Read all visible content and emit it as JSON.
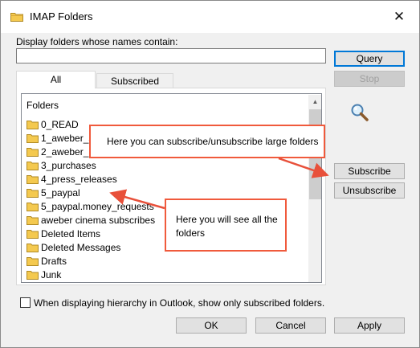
{
  "window": {
    "title": "IMAP Folders",
    "close_glyph": "✕"
  },
  "filter": {
    "label": "Display folders whose names contain:",
    "value": "",
    "query_label": "Query",
    "stop_label": "Stop"
  },
  "tabs": [
    {
      "label": "All",
      "selected": true
    },
    {
      "label": "Subscribed",
      "selected": false
    }
  ],
  "folder_list": {
    "header": "Folders",
    "items": [
      {
        "label": "0_READ"
      },
      {
        "label": "1_aweber_su"
      },
      {
        "label": "2_aweber_ur"
      },
      {
        "label": "3_purchases"
      },
      {
        "label": "4_press_releases"
      },
      {
        "label": "5_paypal"
      },
      {
        "label": "5_paypal.money_requests"
      },
      {
        "label": "aweber cinema subscribes"
      },
      {
        "label": "Deleted Items"
      },
      {
        "label": "Deleted Messages"
      },
      {
        "label": "Drafts"
      },
      {
        "label": "Junk"
      }
    ]
  },
  "side_buttons": {
    "search_icon": "magnifier-icon",
    "subscribe_label": "Subscribe",
    "unsubscribe_label": "Unsubscribe"
  },
  "callouts": {
    "subscribe_note": "Here you can subscribe/unsubscribe large folders",
    "folders_note": "Here you will see all the folders"
  },
  "option": {
    "label": "When displaying hierarchy in Outlook, show only subscribed folders.",
    "checked": false
  },
  "footer": {
    "ok_label": "OK",
    "cancel_label": "Cancel",
    "apply_label": "Apply"
  },
  "colors": {
    "callout_border": "#f05a3c",
    "arrow": "#e8503a",
    "folder_yellow": "#f4c94f",
    "default_button_border": "#0078d7"
  }
}
